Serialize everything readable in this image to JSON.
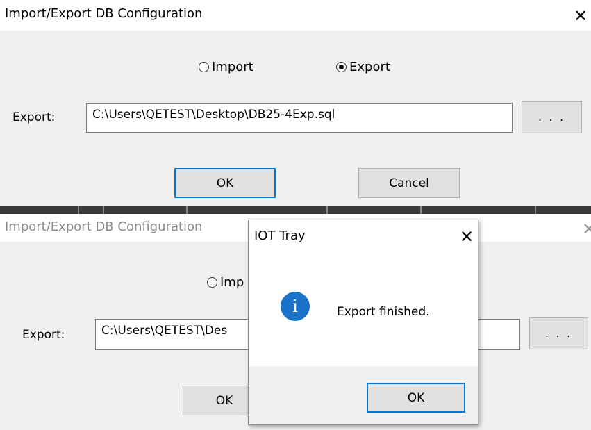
{
  "top_dialog": {
    "title": "Import/Export DB Configuration",
    "close_glyph": "✕",
    "radio_import_label": "Import",
    "radio_export_label": "Export",
    "selected_mode": "Export",
    "export_label": "Export:",
    "export_path": "C:\\Users\\QETEST\\Desktop\\DB25-4Exp.sql",
    "browse_label": ". . .",
    "ok_label": "OK",
    "cancel_label": "Cancel"
  },
  "bottom_dialog": {
    "title": "Import/Export DB Configuration",
    "close_glyph": "✕",
    "radio_import_label": "Imp",
    "export_label": "Export:",
    "export_path": "C:\\Users\\QETEST\\Des",
    "browse_label": ". . .",
    "ok_label": "OK"
  },
  "message_box": {
    "title": "IOT Tray",
    "close_glyph": "✕",
    "icon": "info-icon",
    "icon_glyph": "i",
    "message": "Export finished.",
    "ok_label": "OK"
  },
  "colors": {
    "dialog_bg": "#f0f0f0",
    "accent": "#0078d7",
    "info_icon": "#1a73c9"
  }
}
